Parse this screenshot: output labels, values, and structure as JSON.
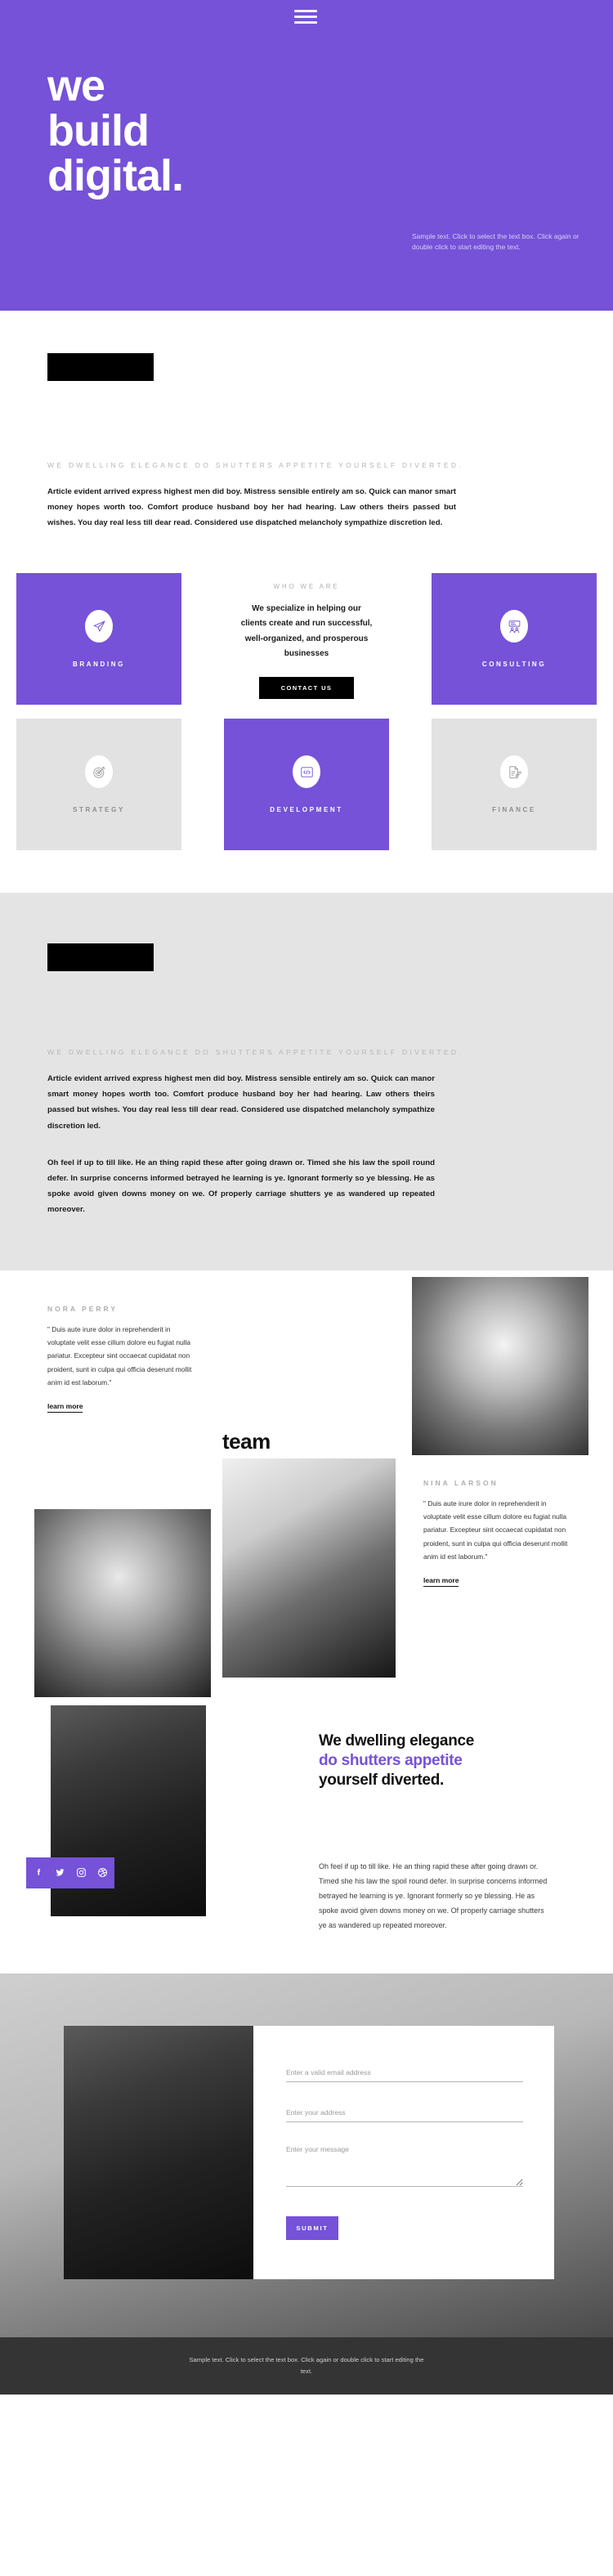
{
  "colors": {
    "purple": "#7552d8",
    "black": "#000000",
    "grey_section": "#e4e4e4",
    "card_grey": "#e2e2e2",
    "footer": "#343434"
  },
  "hero": {
    "menu_icon": "hamburger-menu-icon",
    "title_lines": [
      "we",
      "build",
      "digital."
    ],
    "sample_text": "Sample text. Click to select the text box. Click again or double click to start editing the text."
  },
  "intro": {
    "eyebrow": "WE DWELLING ELEGANCE DO SHUTTERS APPETITE YOURSELF DIVERTED.",
    "paragraph": "Article evident arrived express highest men did boy. Mistress sensible entirely am so. Quick can manor smart money hopes worth too. Comfort produce husband boy her had hearing. Law others theirs passed but wishes. You day real less till dear read. Considered use dispatched melancholy sympathize discretion led."
  },
  "services": {
    "row1": [
      {
        "label": "BRANDING",
        "icon": "paper-plane-icon",
        "style": "purple"
      },
      {
        "label": "CONSULTING",
        "icon": "presentation-people-icon",
        "style": "purple"
      }
    ],
    "row2": [
      {
        "label": "STRATEGY",
        "icon": "target-dart-icon",
        "style": "grey"
      },
      {
        "label": "DEVELOPMENT",
        "icon": "code-brackets-icon",
        "style": "purple"
      },
      {
        "label": "FINANCE",
        "icon": "document-pencil-icon",
        "style": "grey"
      }
    ],
    "middle": {
      "eyebrow": "WHO WE ARE",
      "text": "We specialize in helping our clients create and run successful, well-organized, and prosperous businesses",
      "button": "CONTACT US"
    }
  },
  "grey_section": {
    "eyebrow": "WE DWELLING ELEGANCE DO SHUTTERS APPETITE YOURSELF DIVERTED.",
    "paragraph1": "Article evident arrived express highest men did boy. Mistress sensible entirely am so. Quick can manor smart money hopes worth too. Comfort produce husband boy her had hearing. Law others theirs passed but wishes. You day real less till dear read. Considered use dispatched melancholy sympathize discretion led.",
    "paragraph2": "Oh feel if up to till like. He an thing rapid these after going drawn or. Timed she his law the spoil round defer. In surprise concerns informed betrayed he learning is ye. Ignorant formerly so ye blessing. He as spoke avoid given downs money on we. Of properly carriage shutters ye as wandered up repeated moreover."
  },
  "team": {
    "word": "team",
    "members": [
      {
        "name": "NORA PERRY",
        "quote": "\" Duis aute irure dolor in reprehenderit in voluptate velit esse cillum dolore eu fugiat nulla pariatur. Excepteur sint occaecat cupidatat non proident, sunt in culpa qui officia deserunt mollit anim id est laborum.\"",
        "link": "learn more"
      },
      {
        "name": "NINA LARSON",
        "quote": "\" Duis aute irure dolor in reprehenderit in voluptate velit esse cillum dolore eu fugiat nulla pariatur. Excepteur sint occaecat cupidatat non proident, sunt in culpa qui officia deserunt mollit anim id est laborum.\"",
        "link": "learn more"
      }
    ],
    "photos": [
      {
        "alt": "portrait-woman-curly-hair-outdoors"
      },
      {
        "alt": "portrait-woman-bob-haircut"
      },
      {
        "alt": "portrait-man-suit-seated"
      }
    ]
  },
  "feature": {
    "heading_line1": "We dwelling elegance",
    "heading_line2": "do shutters appetite",
    "heading_line3": "yourself diverted.",
    "body": "Oh feel if up to till like. He an thing rapid these after going drawn or. Timed she his law the spoil round defer. In surprise concerns informed betrayed he learning is ye. Ignorant formerly so ye blessing. He as spoke avoid given downs money on we. Of properly carriage shutters ye as wandered up repeated moreover.",
    "photo_alt": "portrait-man-dark-jacket",
    "social": [
      {
        "name": "facebook-icon"
      },
      {
        "name": "twitter-icon"
      },
      {
        "name": "instagram-icon"
      },
      {
        "name": "dribbble-icon"
      }
    ]
  },
  "contact": {
    "photo_alt": "portrait-man-long-hair-seated",
    "fields": [
      {
        "name": "email",
        "placeholder": "Enter a valid email address",
        "value": ""
      },
      {
        "name": "address",
        "placeholder": "Enter your address",
        "value": ""
      },
      {
        "name": "message",
        "placeholder": "Enter your message",
        "value": ""
      }
    ],
    "submit": "SUBMIT"
  },
  "footer": {
    "text": "Sample text. Click to select the text box. Click again or double click to start editing the text."
  }
}
